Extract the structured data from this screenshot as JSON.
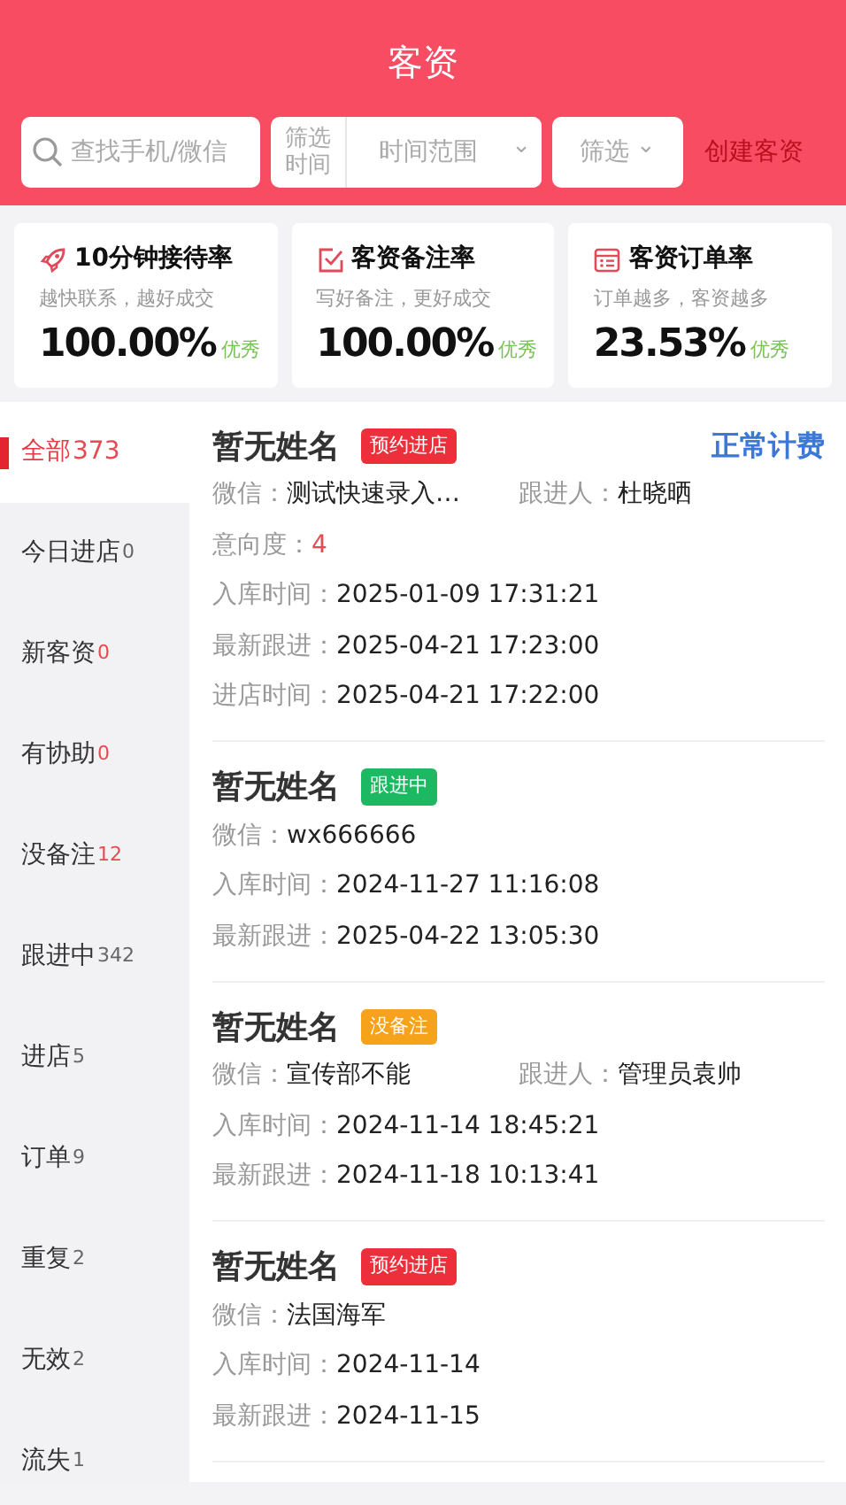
{
  "title": "客资",
  "search": {
    "placeholder": "查找手机/微信"
  },
  "time_filter": {
    "label": "筛选时间",
    "placeholder": "时间范围",
    "caret": "⌄"
  },
  "filter": {
    "label": "筛选",
    "caret": "⌄"
  },
  "create_button": "创建客资",
  "stats": [
    {
      "kind": "rocket",
      "title": "10分钟接待率",
      "subtitle": "越快联系，越好成交",
      "value": "100.00%",
      "grade": "优秀"
    },
    {
      "kind": "check",
      "title": "客资备注率",
      "subtitle": "写好备注，更好成交",
      "value": "100.00%",
      "grade": "优秀"
    },
    {
      "kind": "list",
      "title": "客资订单率",
      "subtitle": "订单越多，客资越多",
      "value": "23.53%",
      "grade": "优秀"
    }
  ],
  "sidebar": [
    {
      "label": "全部",
      "count": "373",
      "selected": true,
      "alert": true
    },
    {
      "label": "今日进店",
      "count": "0",
      "selected": false,
      "alert": false
    },
    {
      "label": "新客资",
      "count": "0",
      "selected": false,
      "alert": true
    },
    {
      "label": "有协助",
      "count": "0",
      "selected": false,
      "alert": true
    },
    {
      "label": "没备注",
      "count": "12",
      "selected": false,
      "alert": true
    },
    {
      "label": "跟进中",
      "count": "342",
      "selected": false,
      "alert": false
    },
    {
      "label": "进店",
      "count": "5",
      "selected": false,
      "alert": false
    },
    {
      "label": "订单",
      "count": "9",
      "selected": false,
      "alert": false
    },
    {
      "label": "重复",
      "count": "2",
      "selected": false,
      "alert": false
    },
    {
      "label": "无效",
      "count": "2",
      "selected": false,
      "alert": false
    },
    {
      "label": "流失",
      "count": "1",
      "selected": false,
      "alert": false
    }
  ],
  "customers": [
    {
      "name": "暂无姓名",
      "tag": "预约进店",
      "color": "#ec2f3b",
      "billing": "正常计费",
      "rows": [
        [
          {
            "label": "微信：",
            "value": "测试快速录入…",
            "highlight": false
          },
          {
            "label": "跟进人：",
            "value": "杜晓晒",
            "highlight": false
          }
        ],
        [
          {
            "label": "意向度：",
            "value": "4",
            "highlight": true
          }
        ],
        [
          {
            "label": "入库时间：",
            "value": "2025-01-09 17:31:21",
            "highlight": false
          }
        ],
        [
          {
            "label": "最新跟进：",
            "value": "2025-04-21 17:23:00",
            "highlight": false
          }
        ],
        [
          {
            "label": "进店时间：",
            "value": "2025-04-21 17:22:00",
            "highlight": false
          }
        ]
      ]
    },
    {
      "name": "暂无姓名",
      "tag": "跟进中",
      "color": "#1db962",
      "rows": [
        [
          {
            "label": "微信：",
            "value": "wx666666",
            "highlight": false
          }
        ],
        [
          {
            "label": "入库时间：",
            "value": "2024-11-27 11:16:08",
            "highlight": false
          }
        ],
        [
          {
            "label": "最新跟进：",
            "value": "2025-04-22 13:05:30",
            "highlight": false
          }
        ]
      ]
    },
    {
      "name": "暂无姓名",
      "tag": "没备注",
      "color": "#f7a21b",
      "rows": [
        [
          {
            "label": "微信：",
            "value": "宣传部不能",
            "highlight": false
          },
          {
            "label": "跟进人：",
            "value": "管理员袁帅",
            "highlight": false
          }
        ],
        [
          {
            "label": "入库时间：",
            "value": "2024-11-14 18:45:21",
            "highlight": false
          }
        ],
        [
          {
            "label": "最新跟进：",
            "value": "2024-11-18 10:13:41",
            "highlight": false
          }
        ]
      ]
    },
    {
      "name": "暂无姓名",
      "tag": "预约进店",
      "color": "#ec2f3b",
      "rows": [
        [
          {
            "label": "微信：",
            "value": "法国海军",
            "highlight": false
          }
        ],
        [
          {
            "label": "入库时间：",
            "value": "2024-11-14",
            "highlight": false
          }
        ],
        [
          {
            "label": "最新跟进：",
            "value": "2024-11-15",
            "highlight": false
          }
        ]
      ]
    }
  ]
}
